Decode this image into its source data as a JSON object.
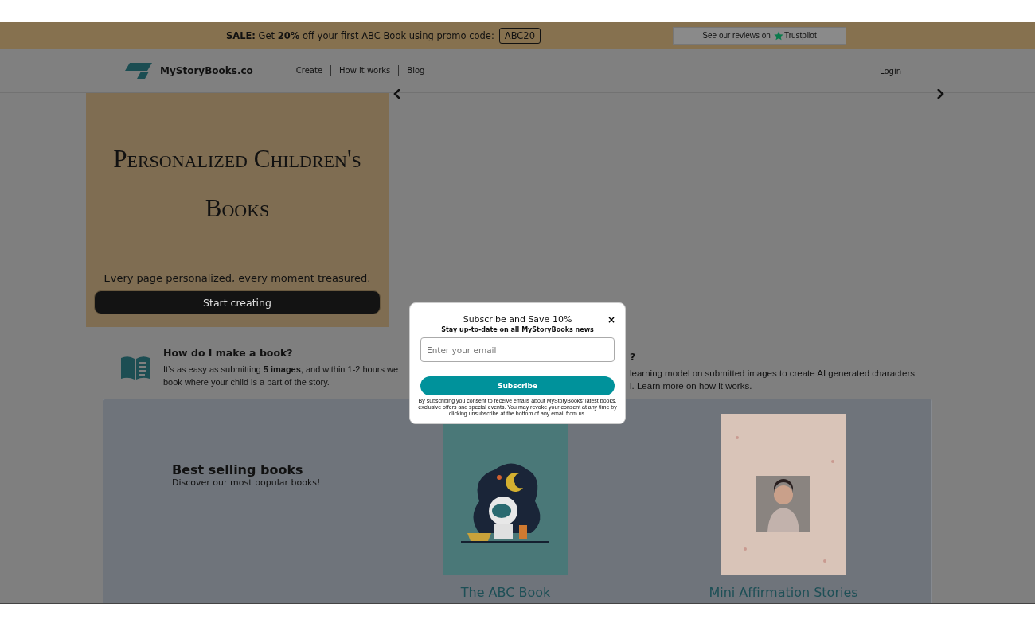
{
  "banner": {
    "sale_text": "**SALE:** Get **20%** off your first ABC Book using promo code:",
    "promo_code": "ABC20",
    "reviews_text": "See our reviews on",
    "reviews_brand": "Trustpilot"
  },
  "nav": {
    "brand": "MyStoryBooks.co",
    "links": [
      "Create",
      "How it works",
      "Blog"
    ],
    "login": "Login"
  },
  "hero": {
    "title": "Personalized Children's Books",
    "tagline": "Every page personalized, every moment treasured.",
    "button": "Start creating"
  },
  "info": [
    {
      "heading": "How do I make a book?",
      "body_lines": [
        "It’s as easy as submitting **5 images**, and within 1-2 hours we",
        "book where your child is a part of the story."
      ]
    },
    {
      "heading": "?",
      "body_lines": [
        "learning model on submitted images to create AI generated characters",
        "l. Learn more on how it works."
      ]
    }
  ],
  "best_selling": {
    "title": "Best selling books",
    "subtitle": "Discover our most popular books!",
    "books": [
      {
        "title": "The ABC Book",
        "kind": "picture"
      },
      {
        "title": "Mini Affirmation Stories",
        "kind": "picture"
      }
    ]
  },
  "popup": {
    "title": "Subscribe and Save 10%",
    "subtitle": "Stay up-to-date on all MyStoryBooks news",
    "close": "×",
    "email_placeholder": "Enter your email",
    "button": "Subscribe",
    "fine_print": "By subscribing you consent to receive emails about MyStoryBooks' latest books, exclusive offers and special events. You may revoke your consent at any time by clicking unsubscribe at the bottom of any email from us."
  }
}
